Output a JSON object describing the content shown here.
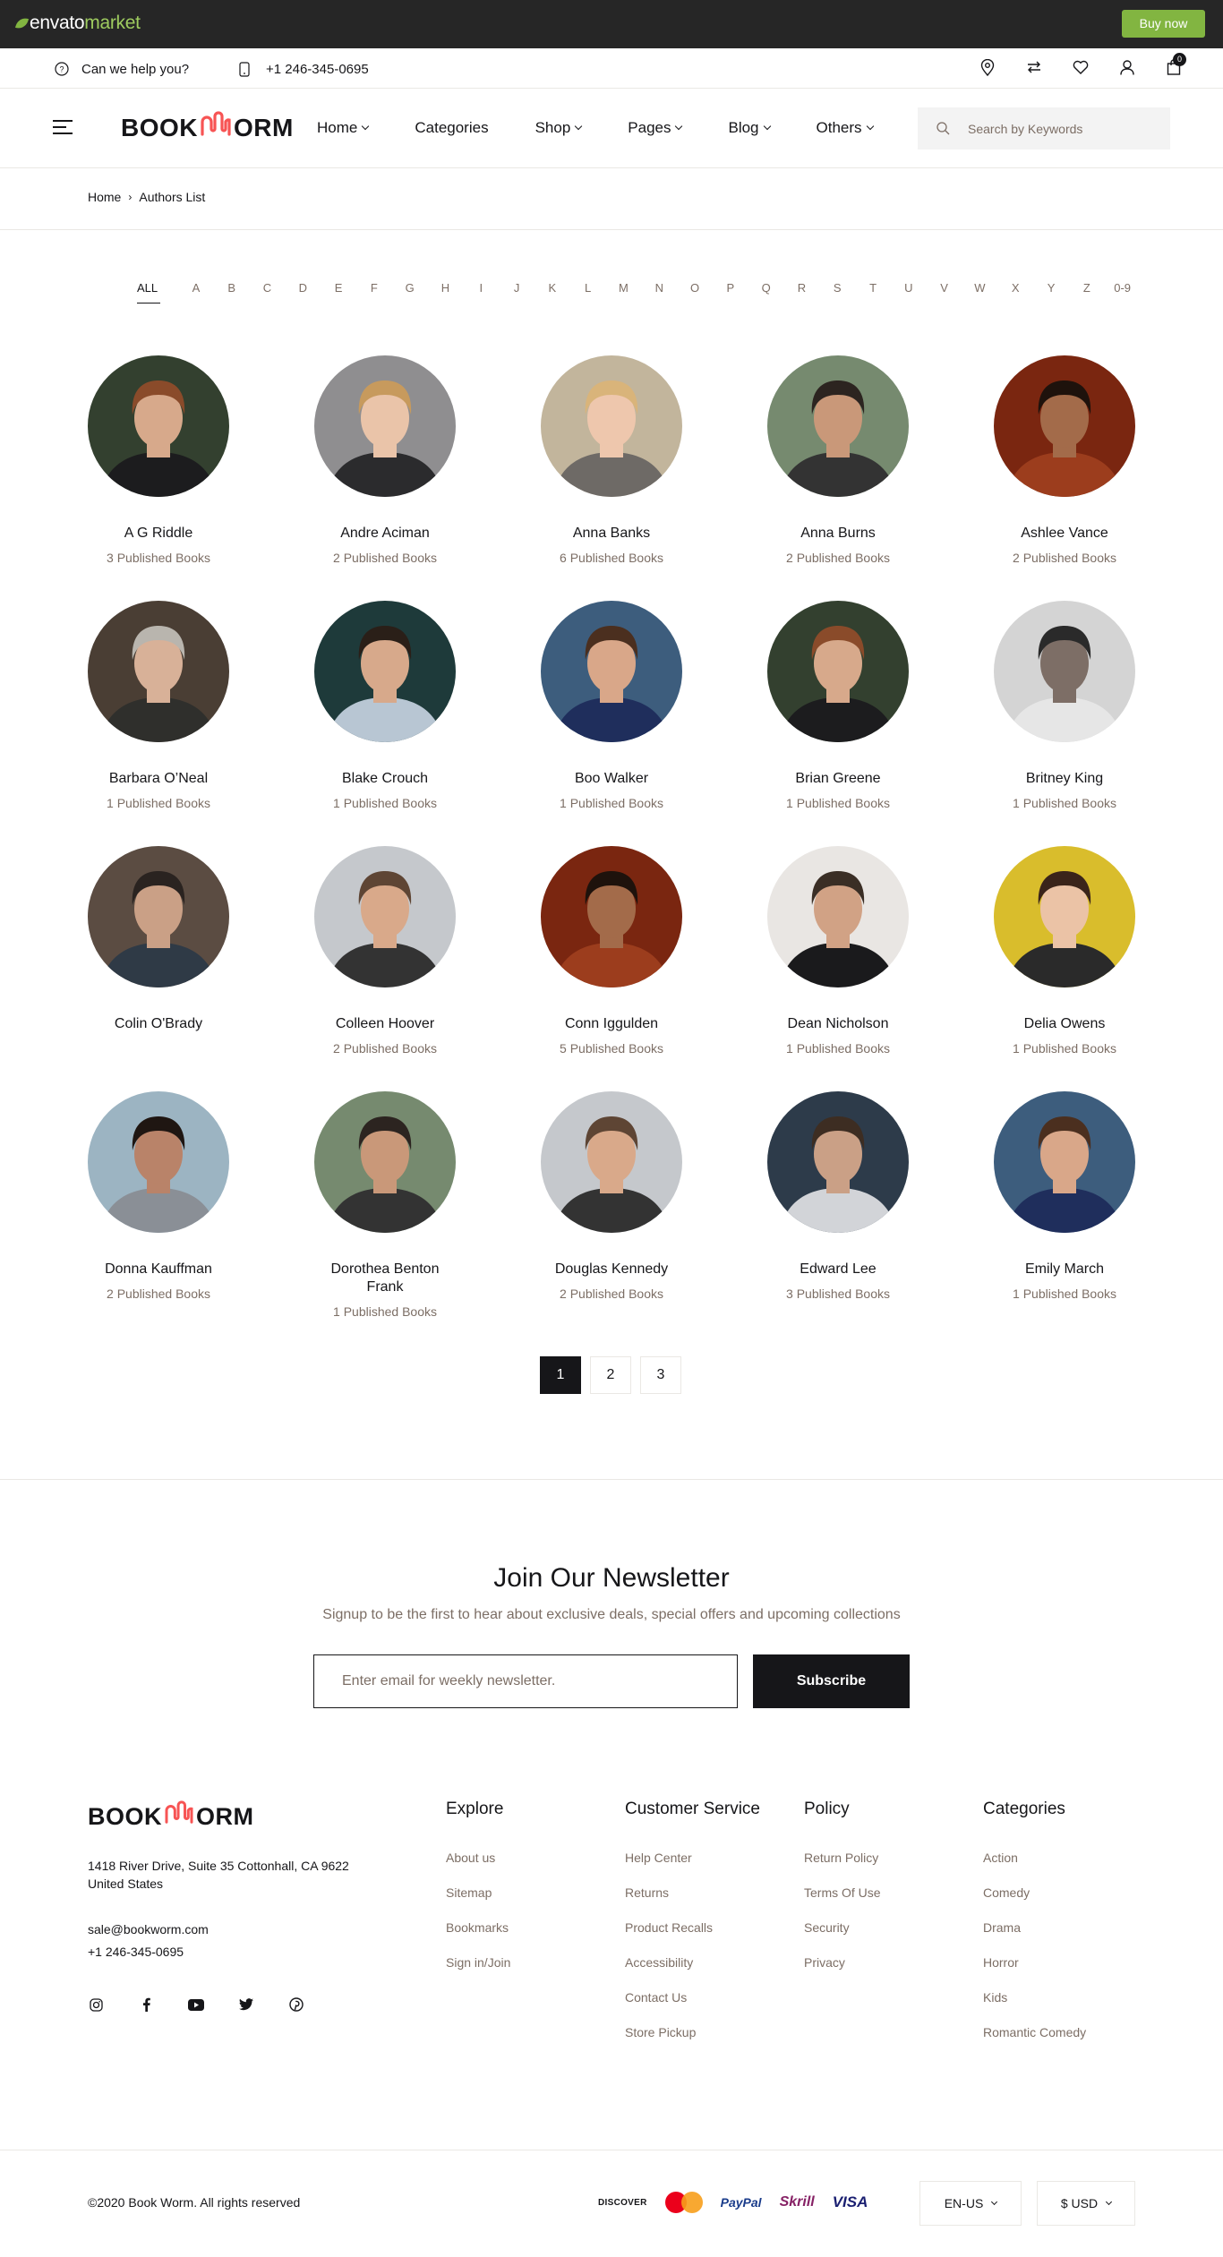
{
  "envato": {
    "logo_envato": "envato",
    "logo_market": "market",
    "buy_now": "Buy now"
  },
  "topbar": {
    "help": "Can we help you?",
    "phone": "+1 246-345-0695",
    "cart_count": "0",
    "icons": [
      "map-marker-icon",
      "compare-arrows-icon",
      "heart-icon",
      "user-icon",
      "shopping-bag-icon"
    ]
  },
  "header": {
    "logo_left": "BOOK",
    "logo_right": "ORM",
    "nav": [
      "Home",
      "Categories",
      "Shop",
      "Pages",
      "Blog",
      "Others"
    ],
    "search_placeholder": "Search by Keywords"
  },
  "breadcrumb": {
    "home": "Home",
    "separator": "›",
    "current": "Authors List"
  },
  "letters": [
    "ALL",
    "A",
    "B",
    "C",
    "D",
    "E",
    "F",
    "G",
    "H",
    "I",
    "J",
    "K",
    "L",
    "M",
    "N",
    "O",
    "P",
    "Q",
    "R",
    "S",
    "T",
    "U",
    "V",
    "W",
    "X",
    "Y",
    "Z",
    "0-9"
  ],
  "authors": [
    {
      "name": "A G Riddle",
      "books": "3 Published Books",
      "bg": "#33402f",
      "skin": "#d7a98b",
      "hair": "#8a4b2a",
      "shirt": "#1c1c1e"
    },
    {
      "name": "Andre Aciman",
      "books": "2 Published Books",
      "bg": "#8f8e90",
      "skin": "#eac4a9",
      "hair": "#c79a5d",
      "shirt": "#2b2b2d"
    },
    {
      "name": "Anna Banks",
      "books": "6 Published Books",
      "bg": "#c2b59c",
      "skin": "#eec7ad",
      "hair": "#d9b47a",
      "shirt": "#6e6a66"
    },
    {
      "name": "Anna Burns",
      "books": "2 Published Books",
      "bg": "#768a6f",
      "skin": "#c99879",
      "hair": "#2c2420",
      "shirt": "#333333"
    },
    {
      "name": "Ashlee Vance",
      "books": "2 Published Books",
      "bg": "#7a2610",
      "skin": "#a36b4a",
      "hair": "#1e120c",
      "shirt": "#9c3d1d"
    },
    {
      "name": "Barbara O’Neal",
      "books": "1 Published Books",
      "bg": "#4a3e34",
      "skin": "#d8b198",
      "hair": "#b9b5ae",
      "shirt": "#2f2f2c"
    },
    {
      "name": "Blake Crouch",
      "books": "1 Published Books",
      "bg": "#1e3a3a",
      "skin": "#d7a98b",
      "hair": "#2a1f18",
      "shirt": "#b8c6d3"
    },
    {
      "name": "Boo Walker",
      "books": "1 Published Books",
      "bg": "#3d5d7d",
      "skin": "#d9a789",
      "hair": "#4b2f1f",
      "shirt": "#1f2e5c"
    },
    {
      "name": "Brian Greene",
      "books": "1 Published Books",
      "bg": "#33402f",
      "skin": "#d7a98b",
      "hair": "#8a4b2a",
      "shirt": "#1c1c1e"
    },
    {
      "name": "Britney King",
      "books": "1 Published Books",
      "bg": "#d4d4d4",
      "skin": "#7d6e66",
      "hair": "#2a2a2a",
      "shirt": "#e6e6e6"
    },
    {
      "name": "Colin O'Brady",
      "books": "",
      "bg": "#5b4c42",
      "skin": "#caa086",
      "hair": "#2a2320",
      "shirt": "#2f3a46"
    },
    {
      "name": "Colleen Hoover",
      "books": "2 Published Books",
      "bg": "#c5c8cc",
      "skin": "#d9a98a",
      "hair": "#5e4534",
      "shirt": "#333"
    },
    {
      "name": "Conn Iggulden",
      "books": "5 Published Books",
      "bg": "#7a2610",
      "skin": "#a36b4a",
      "hair": "#1e120c",
      "shirt": "#9c3d1d"
    },
    {
      "name": "Dean Nicholson",
      "books": "1 Published Books",
      "bg": "#e9e6e3",
      "skin": "#d1a285",
      "hair": "#3a2e25",
      "shirt": "#1a1a1c"
    },
    {
      "name": "Delia Owens",
      "books": "1 Published Books",
      "bg": "#d9bd2c",
      "skin": "#ebc3a6",
      "hair": "#3a241a",
      "shirt": "#2a2a2a"
    },
    {
      "name": "Donna Kauffman",
      "books": "2 Published Books",
      "bg": "#9cb4c2",
      "skin": "#b98369",
      "hair": "#1f1612",
      "shirt": "#8a8f96"
    },
    {
      "name": "Dorothea Benton Frank",
      "books": "1 Published Books",
      "bg": "#768a6f",
      "skin": "#c99879",
      "hair": "#2c2420",
      "shirt": "#333333"
    },
    {
      "name": "Douglas Kennedy",
      "books": "2 Published Books",
      "bg": "#c5c8cc",
      "skin": "#d9a98a",
      "hair": "#5e4534",
      "shirt": "#333"
    },
    {
      "name": "Edward Lee",
      "books": "3 Published Books",
      "bg": "#2d3b4a",
      "skin": "#caa086",
      "hair": "#3d2d22",
      "shirt": "#d2d4d8"
    },
    {
      "name": "Emily March",
      "books": "1 Published Books",
      "bg": "#3d5d7d",
      "skin": "#d9a789",
      "hair": "#4b2f1f",
      "shirt": "#1f2e5c"
    }
  ],
  "pagination": [
    "1",
    "2",
    "3"
  ],
  "newsletter": {
    "title": "Join Our Newsletter",
    "subtitle": "Signup to be the first to hear about exclusive deals, special offers and upcoming collections",
    "placeholder": "Enter email for weekly newsletter.",
    "button": "Subscribe"
  },
  "footer": {
    "address": "1418 River Drive, Suite 35 Cottonhall, CA 9622 United States",
    "email": "sale@bookworm.com",
    "phone": "+1 246-345-0695",
    "socials": [
      "instagram-icon",
      "facebook-icon",
      "youtube-icon",
      "twitter-icon",
      "pinterest-icon"
    ],
    "columns": [
      {
        "title": "Explore",
        "links": [
          "About us",
          "Sitemap",
          "Bookmarks",
          "Sign in/Join"
        ]
      },
      {
        "title": "Customer Service",
        "links": [
          "Help Center",
          "Returns",
          "Product Recalls",
          "Accessibility",
          "Contact Us",
          "Store Pickup"
        ]
      },
      {
        "title": "Policy",
        "links": [
          "Return Policy",
          "Terms Of Use",
          "Security",
          "Privacy"
        ]
      },
      {
        "title": "Categories",
        "links": [
          "Action",
          "Comedy",
          "Drama",
          "Horror",
          "Kids",
          "Romantic Comedy"
        ]
      }
    ],
    "copyright": "©2020 Book Worm. All rights reserved",
    "payments": {
      "discover": "DISCOVER",
      "paypal": "PayPal",
      "skrill": "Skrill",
      "visa": "VISA"
    },
    "language": "EN-US",
    "currency": "$ USD"
  },
  "colors": {
    "accent": "#f75454",
    "dark": "#161619",
    "muted": "#7c6e65",
    "envato_green": "#82b541"
  }
}
